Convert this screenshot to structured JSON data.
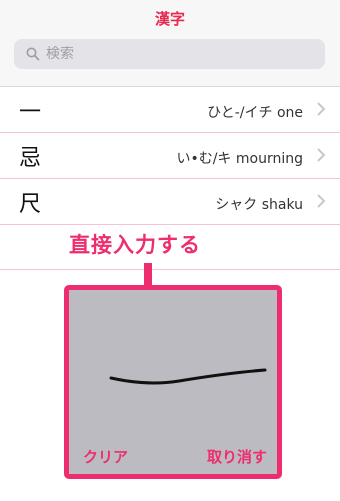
{
  "nav": {
    "title": "漢字"
  },
  "search": {
    "placeholder": "検索"
  },
  "list": {
    "items": [
      {
        "kanji": "一",
        "reading": "ひと-/イチ one"
      },
      {
        "kanji": "忌",
        "reading": "い•む/キ mourning"
      },
      {
        "kanji": "尺",
        "reading": "シャク shaku"
      }
    ]
  },
  "annotation": {
    "label": "直接入力する"
  },
  "handwriting": {
    "clear_label": "クリア",
    "undo_label": "取り消す"
  },
  "colors": {
    "accent": "#ee2d6e",
    "title": "#e8294f",
    "pad_bg": "#bcbbc1",
    "separator": "#f4c3cf"
  }
}
